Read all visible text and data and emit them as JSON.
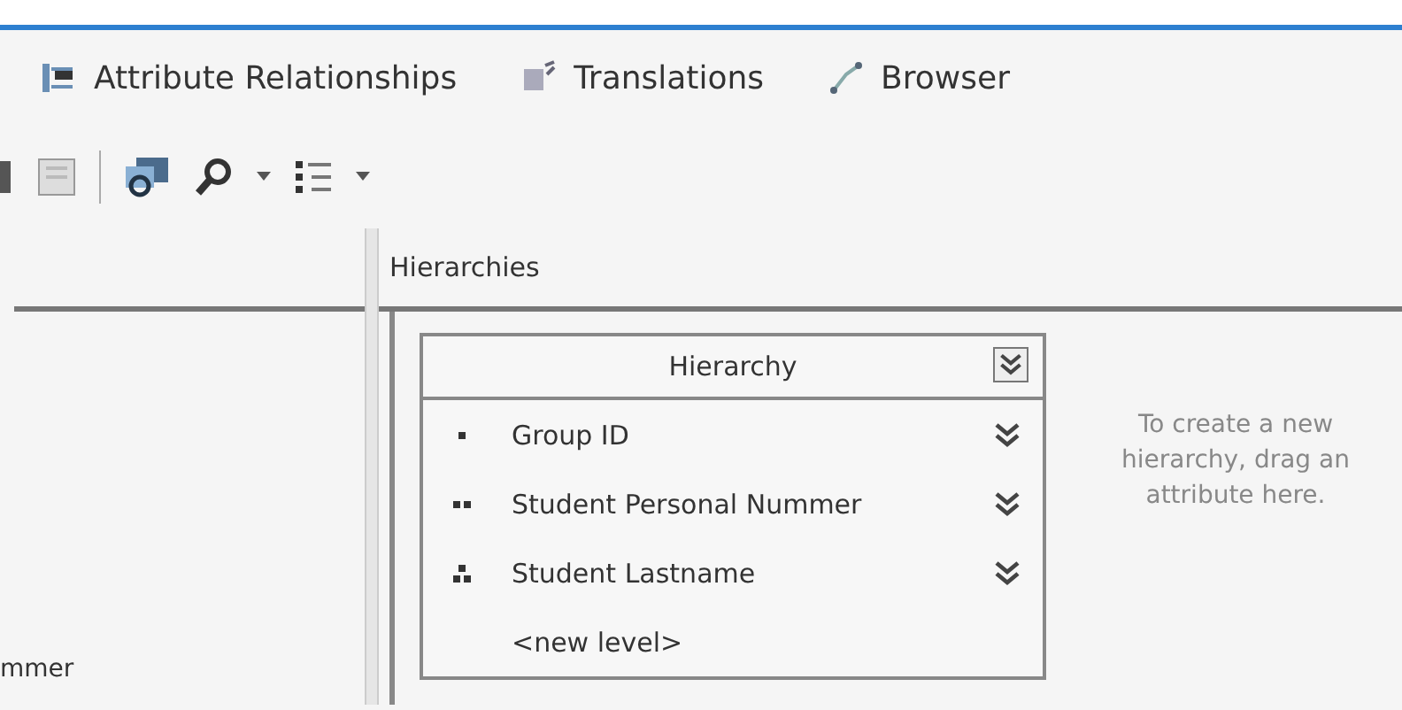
{
  "tabs": [
    {
      "label": "Attribute Relationships",
      "selected": false
    },
    {
      "label": "Translations",
      "selected": false
    },
    {
      "label": "Browser",
      "selected": false
    }
  ],
  "left_panel": {
    "cut_text": "mmer"
  },
  "hierarchies_panel": {
    "title": "Hierarchies",
    "hierarchy": {
      "title": "Hierarchy",
      "levels": [
        {
          "kind": "level",
          "name": "Group ID"
        },
        {
          "kind": "level",
          "name": "Student Personal Nummer"
        },
        {
          "kind": "level",
          "name": "Student Lastname"
        },
        {
          "kind": "new",
          "name": "<new level>"
        }
      ]
    },
    "hint": "To create a new hierarchy, drag an attribute here."
  }
}
